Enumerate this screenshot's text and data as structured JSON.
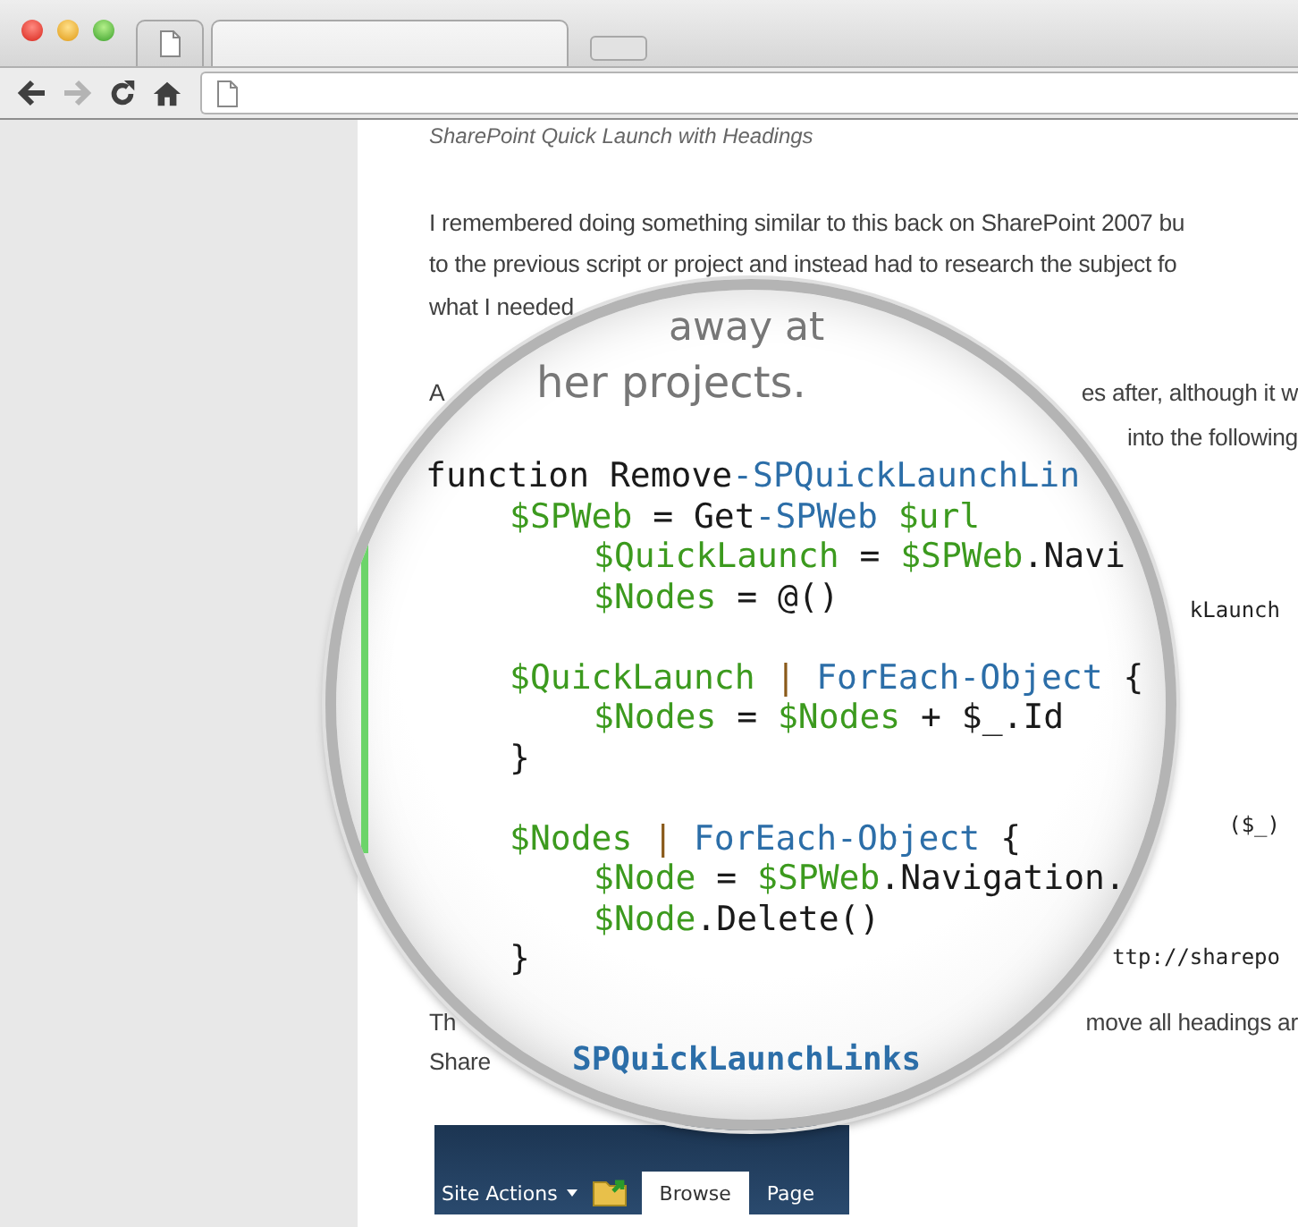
{
  "browser": {
    "tabs": [
      {
        "selected": false
      },
      {
        "selected": true
      }
    ],
    "toolbar": [
      {
        "kind": "back",
        "disabled": false
      },
      {
        "kind": "forward",
        "disabled": true
      },
      {
        "kind": "reload",
        "disabled": false
      },
      {
        "kind": "home",
        "disabled": false
      }
    ]
  },
  "article": {
    "caption": "SharePoint Quick Launch with Headings",
    "lines": [
      {
        "left": "I remembered doing something similar to this back on SharePoint 2007 bu"
      },
      {
        "left": "to the previous script or project and instead had to research the subject fo"
      },
      {
        "left": "what I needed"
      },
      {
        "left": "A",
        "right": "es after, although it w"
      },
      {
        "right": "into the following"
      },
      {
        "right": "kLaunch",
        "kind": "code"
      },
      {
        "right": "($_)",
        "kind": "code"
      },
      {
        "right": "ttp://sharepo",
        "kind": "code"
      },
      {
        "left": "Th",
        "right": "move all headings ar"
      },
      {
        "left": "Share"
      }
    ],
    "ribbon": {
      "site_actions": "Site Actions",
      "tabs": [
        {
          "label": "Browse",
          "selected": true
        },
        {
          "label": "Page",
          "selected": false
        }
      ]
    }
  },
  "lens": {
    "magnified_text": [
      "away at",
      "her projects."
    ],
    "code": {
      "tokens": [
        {
          "kind": "keyword",
          "text": "function Remove"
        },
        {
          "kind": "command",
          "text": "-SPQuickLaunchLin"
        }
      ],
      "children": [
        {
          "tokens": [
            {
              "kind": "variable",
              "text": "$SPWeb"
            },
            {
              "kind": "plain",
              "text": " = Get"
            },
            {
              "kind": "command",
              "text": "-SPWeb"
            },
            {
              "kind": "variable",
              "text": " $url"
            }
          ],
          "children": [
            {
              "tokens": [
                {
                  "kind": "variable",
                  "text": "$QuickLaunch"
                },
                {
                  "kind": "plain",
                  "text": " = "
                },
                {
                  "kind": "variable",
                  "text": "$SPWeb"
                },
                {
                  "kind": "plain",
                  "text": ".Navi"
                }
              ]
            },
            {
              "tokens": [
                {
                  "kind": "variable",
                  "text": "$Nodes"
                },
                {
                  "kind": "plain",
                  "text": " = @()"
                }
              ]
            }
          ]
        },
        {
          "tokens": [
            {
              "kind": "variable",
              "text": "$QuickLaunch"
            },
            {
              "kind": "operator",
              "text": " | "
            },
            {
              "kind": "command",
              "text": "ForEach-Object"
            },
            {
              "kind": "plain",
              "text": " {"
            }
          ],
          "children": [
            {
              "tokens": [
                {
                  "kind": "variable",
                  "text": "$Nodes"
                },
                {
                  "kind": "plain",
                  "text": " = "
                },
                {
                  "kind": "variable",
                  "text": "$Nodes"
                },
                {
                  "kind": "plain",
                  "text": " + $_.Id"
                }
              ]
            }
          ],
          "close": "}"
        },
        {
          "tokens": [
            {
              "kind": "variable",
              "text": "$Nodes"
            },
            {
              "kind": "operator",
              "text": " | "
            },
            {
              "kind": "command",
              "text": "ForEach-Object"
            },
            {
              "kind": "plain",
              "text": " {"
            }
          ],
          "children": [
            {
              "tokens": [
                {
                  "kind": "variable",
                  "text": "$Node"
                },
                {
                  "kind": "plain",
                  "text": " = "
                },
                {
                  "kind": "variable",
                  "text": "$SPWeb"
                },
                {
                  "kind": "plain",
                  "text": ".Navigation."
                }
              ]
            },
            {
              "tokens": [
                {
                  "kind": "variable",
                  "text": "$Node"
                },
                {
                  "kind": "plain",
                  "text": ".Delete()"
                }
              ]
            }
          ],
          "close": "}"
        }
      ]
    },
    "bottom_text": "SPQuickLaunchLinks"
  }
}
